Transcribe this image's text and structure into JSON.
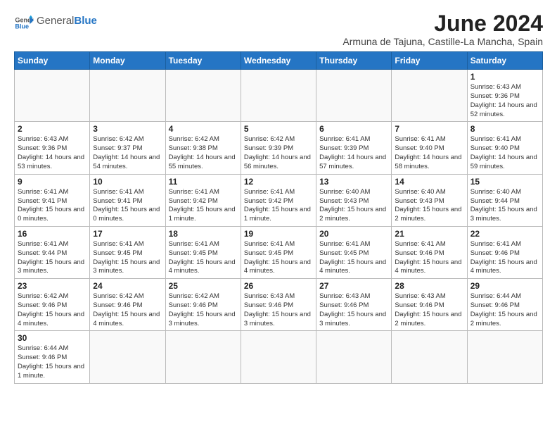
{
  "logo": {
    "text_general": "General",
    "text_blue": "Blue"
  },
  "title": "June 2024",
  "subtitle": "Armuna de Tajuna, Castille-La Mancha, Spain",
  "headers": [
    "Sunday",
    "Monday",
    "Tuesday",
    "Wednesday",
    "Thursday",
    "Friday",
    "Saturday"
  ],
  "weeks": [
    [
      {
        "day": "",
        "info": ""
      },
      {
        "day": "",
        "info": ""
      },
      {
        "day": "",
        "info": ""
      },
      {
        "day": "",
        "info": ""
      },
      {
        "day": "",
        "info": ""
      },
      {
        "day": "",
        "info": ""
      },
      {
        "day": "1",
        "info": "Sunrise: 6:43 AM\nSunset: 9:36 PM\nDaylight: 14 hours and 52 minutes."
      }
    ],
    [
      {
        "day": "2",
        "info": "Sunrise: 6:43 AM\nSunset: 9:36 PM\nDaylight: 14 hours and 53 minutes."
      },
      {
        "day": "3",
        "info": "Sunrise: 6:42 AM\nSunset: 9:37 PM\nDaylight: 14 hours and 54 minutes."
      },
      {
        "day": "4",
        "info": "Sunrise: 6:42 AM\nSunset: 9:38 PM\nDaylight: 14 hours and 55 minutes."
      },
      {
        "day": "5",
        "info": "Sunrise: 6:42 AM\nSunset: 9:39 PM\nDaylight: 14 hours and 56 minutes."
      },
      {
        "day": "6",
        "info": "Sunrise: 6:41 AM\nSunset: 9:39 PM\nDaylight: 14 hours and 57 minutes."
      },
      {
        "day": "7",
        "info": "Sunrise: 6:41 AM\nSunset: 9:40 PM\nDaylight: 14 hours and 58 minutes."
      },
      {
        "day": "8",
        "info": "Sunrise: 6:41 AM\nSunset: 9:40 PM\nDaylight: 14 hours and 59 minutes."
      }
    ],
    [
      {
        "day": "9",
        "info": "Sunrise: 6:41 AM\nSunset: 9:41 PM\nDaylight: 15 hours and 0 minutes."
      },
      {
        "day": "10",
        "info": "Sunrise: 6:41 AM\nSunset: 9:41 PM\nDaylight: 15 hours and 0 minutes."
      },
      {
        "day": "11",
        "info": "Sunrise: 6:41 AM\nSunset: 9:42 PM\nDaylight: 15 hours and 1 minute."
      },
      {
        "day": "12",
        "info": "Sunrise: 6:41 AM\nSunset: 9:42 PM\nDaylight: 15 hours and 1 minute."
      },
      {
        "day": "13",
        "info": "Sunrise: 6:40 AM\nSunset: 9:43 PM\nDaylight: 15 hours and 2 minutes."
      },
      {
        "day": "14",
        "info": "Sunrise: 6:40 AM\nSunset: 9:43 PM\nDaylight: 15 hours and 2 minutes."
      },
      {
        "day": "15",
        "info": "Sunrise: 6:40 AM\nSunset: 9:44 PM\nDaylight: 15 hours and 3 minutes."
      }
    ],
    [
      {
        "day": "16",
        "info": "Sunrise: 6:41 AM\nSunset: 9:44 PM\nDaylight: 15 hours and 3 minutes."
      },
      {
        "day": "17",
        "info": "Sunrise: 6:41 AM\nSunset: 9:45 PM\nDaylight: 15 hours and 3 minutes."
      },
      {
        "day": "18",
        "info": "Sunrise: 6:41 AM\nSunset: 9:45 PM\nDaylight: 15 hours and 4 minutes."
      },
      {
        "day": "19",
        "info": "Sunrise: 6:41 AM\nSunset: 9:45 PM\nDaylight: 15 hours and 4 minutes."
      },
      {
        "day": "20",
        "info": "Sunrise: 6:41 AM\nSunset: 9:45 PM\nDaylight: 15 hours and 4 minutes."
      },
      {
        "day": "21",
        "info": "Sunrise: 6:41 AM\nSunset: 9:46 PM\nDaylight: 15 hours and 4 minutes."
      },
      {
        "day": "22",
        "info": "Sunrise: 6:41 AM\nSunset: 9:46 PM\nDaylight: 15 hours and 4 minutes."
      }
    ],
    [
      {
        "day": "23",
        "info": "Sunrise: 6:42 AM\nSunset: 9:46 PM\nDaylight: 15 hours and 4 minutes."
      },
      {
        "day": "24",
        "info": "Sunrise: 6:42 AM\nSunset: 9:46 PM\nDaylight: 15 hours and 4 minutes."
      },
      {
        "day": "25",
        "info": "Sunrise: 6:42 AM\nSunset: 9:46 PM\nDaylight: 15 hours and 3 minutes."
      },
      {
        "day": "26",
        "info": "Sunrise: 6:43 AM\nSunset: 9:46 PM\nDaylight: 15 hours and 3 minutes."
      },
      {
        "day": "27",
        "info": "Sunrise: 6:43 AM\nSunset: 9:46 PM\nDaylight: 15 hours and 3 minutes."
      },
      {
        "day": "28",
        "info": "Sunrise: 6:43 AM\nSunset: 9:46 PM\nDaylight: 15 hours and 2 minutes."
      },
      {
        "day": "29",
        "info": "Sunrise: 6:44 AM\nSunset: 9:46 PM\nDaylight: 15 hours and 2 minutes."
      }
    ],
    [
      {
        "day": "30",
        "info": "Sunrise: 6:44 AM\nSunset: 9:46 PM\nDaylight: 15 hours and 1 minute."
      },
      {
        "day": "",
        "info": ""
      },
      {
        "day": "",
        "info": ""
      },
      {
        "day": "",
        "info": ""
      },
      {
        "day": "",
        "info": ""
      },
      {
        "day": "",
        "info": ""
      },
      {
        "day": "",
        "info": ""
      }
    ]
  ]
}
